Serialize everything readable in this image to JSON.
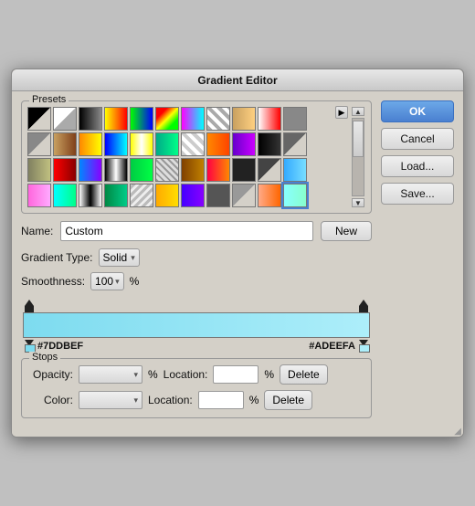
{
  "window": {
    "title": "Gradient Editor"
  },
  "presets": {
    "label": "Presets",
    "nav_arrow": "▶"
  },
  "name_row": {
    "label": "Name:",
    "value": "Custom",
    "placeholder": "Custom",
    "new_button": "New"
  },
  "gradient_type_row": {
    "label": "Gradient Type:",
    "value": "Solid",
    "arrow": "▾"
  },
  "smoothness_row": {
    "label": "Smoothness:",
    "value": "100",
    "arrow": "▾",
    "unit": "%"
  },
  "gradient_colors": {
    "left": "#7DDBEF",
    "right": "#ADEEFA"
  },
  "stops_group": {
    "label": "Stops",
    "opacity_row": {
      "label": "Opacity:",
      "value": "",
      "unit": "%",
      "location_label": "Location:",
      "location_value": "",
      "location_unit": "%",
      "delete_button": "Delete"
    },
    "color_row": {
      "label": "Color:",
      "value": "",
      "location_label": "Location:",
      "location_value": "",
      "location_unit": "%",
      "delete_button": "Delete"
    }
  },
  "buttons": {
    "ok": "OK",
    "cancel": "Cancel",
    "load": "Load...",
    "save": "Save..."
  },
  "swatches": [
    {
      "bg": "linear-gradient(135deg, #000 50%, transparent 50%)",
      "label": "swatch-1"
    },
    {
      "bg": "linear-gradient(135deg, #fff 50%, #aaa 50%)",
      "label": "swatch-2"
    },
    {
      "bg": "linear-gradient(to right, #000, #888)",
      "label": "swatch-3"
    },
    {
      "bg": "linear-gradient(to right, #ff0, #f00)",
      "label": "swatch-4"
    },
    {
      "bg": "linear-gradient(to right, #0f0, #00f)",
      "label": "swatch-5"
    },
    {
      "bg": "linear-gradient(135deg, #f00 25%, #ff0 50%, #0f0 75%)",
      "label": "swatch-6"
    },
    {
      "bg": "linear-gradient(to right, #f0f, #0ff)",
      "label": "swatch-7"
    },
    {
      "bg": "repeating-linear-gradient(45deg, #aaa 0, #aaa 4px, #fff 4px, #fff 8px)",
      "label": "swatch-8"
    },
    {
      "bg": "linear-gradient(to right, #c8a060, #ffd080)",
      "label": "swatch-9"
    },
    {
      "bg": "linear-gradient(to right, #fff, #f00)",
      "label": "swatch-10"
    },
    {
      "bg": "#888",
      "label": "swatch-11"
    },
    {
      "bg": "linear-gradient(135deg, #888 50%, transparent 50%)",
      "label": "swatch-12"
    },
    {
      "bg": "linear-gradient(to right, #c8a060, #80401a)",
      "label": "swatch-13"
    },
    {
      "bg": "linear-gradient(to right, #f80, #ff0)",
      "label": "swatch-14"
    },
    {
      "bg": "linear-gradient(to right, #00f, #0ff)",
      "label": "swatch-15"
    },
    {
      "bg": "linear-gradient(to right, #ff0, #fff, #ff0)",
      "label": "swatch-16"
    },
    {
      "bg": "linear-gradient(to right, #0a8, #0f8)",
      "label": "swatch-17"
    },
    {
      "bg": "repeating-linear-gradient(45deg, #ccc 0, #ccc 4px, #fff 4px, #fff 8px)",
      "label": "swatch-18"
    },
    {
      "bg": "linear-gradient(to right, #f80, #f40)",
      "label": "swatch-19"
    },
    {
      "bg": "linear-gradient(to right, #60c, #c0f)",
      "label": "swatch-20"
    },
    {
      "bg": "linear-gradient(to right, #000, #333)",
      "label": "swatch-21"
    },
    {
      "bg": "linear-gradient(135deg, #666 50%, transparent 50%)",
      "label": "swatch-22"
    },
    {
      "bg": "linear-gradient(to right, #808060, #c0c080)",
      "label": "swatch-23"
    },
    {
      "bg": "linear-gradient(to right, #f00, #800)",
      "label": "swatch-24"
    },
    {
      "bg": "linear-gradient(to right, #08f, #80f)",
      "label": "swatch-25"
    },
    {
      "bg": "linear-gradient(to right, #000, #fff, #000)",
      "label": "swatch-26"
    },
    {
      "bg": "linear-gradient(to right, #0c4, #0f4)",
      "label": "swatch-27"
    },
    {
      "bg": "repeating-linear-gradient(45deg, #999 0, #999 2px, #ddd 2px, #ddd 5px)",
      "label": "swatch-28"
    },
    {
      "bg": "linear-gradient(to right, #804000, #c08000)",
      "label": "swatch-29"
    },
    {
      "bg": "linear-gradient(to right, #f04, #f80)",
      "label": "swatch-30"
    },
    {
      "bg": "#222",
      "label": "swatch-31"
    },
    {
      "bg": "linear-gradient(135deg, #444 50%, transparent 50%)",
      "label": "swatch-32"
    },
    {
      "bg": "linear-gradient(to right, #3af, #7df)",
      "label": "swatch-33"
    },
    {
      "bg": "linear-gradient(to right, #f6d, #faf)",
      "label": "swatch-34"
    },
    {
      "bg": "linear-gradient(to right, #0ff, #0f8)",
      "label": "swatch-35"
    },
    {
      "bg": "linear-gradient(to right, #fff, #000, #fff)",
      "label": "swatch-36"
    },
    {
      "bg": "linear-gradient(to right, #084, #0c8)",
      "label": "swatch-37"
    },
    {
      "bg": "repeating-linear-gradient(-45deg, #bbb 0, #bbb 3px, #eee 3px, #eee 6px)",
      "label": "swatch-38"
    },
    {
      "bg": "linear-gradient(to right, #fa0, #fd0)",
      "label": "swatch-39"
    },
    {
      "bg": "linear-gradient(to right, #40f, #80f)",
      "label": "swatch-40"
    },
    {
      "bg": "#555",
      "label": "swatch-41"
    },
    {
      "bg": "linear-gradient(135deg, #999 50%, transparent 50%)",
      "label": "swatch-42"
    },
    {
      "bg": "linear-gradient(to right, #fa8, #f60)",
      "label": "swatch-43"
    },
    {
      "bg": "linear-gradient(to right, #8ff, #8fc)",
      "label": "swatch-44"
    }
  ]
}
